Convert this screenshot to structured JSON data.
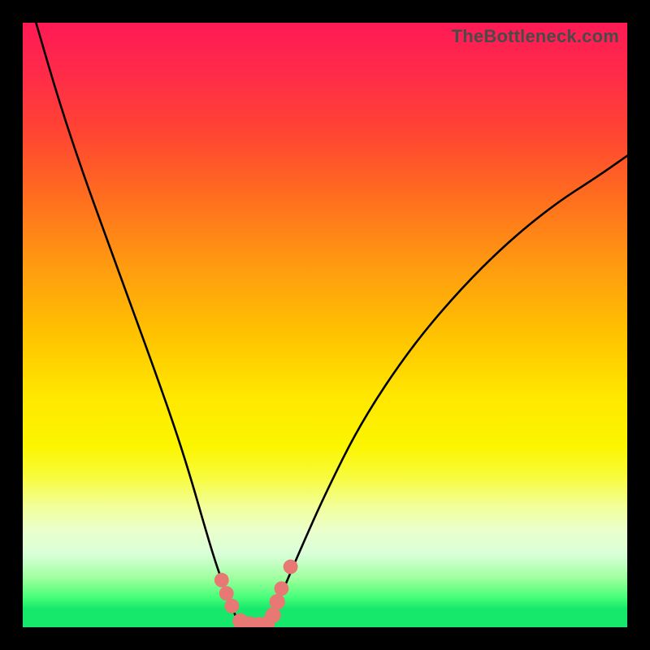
{
  "watermark": "TheBottleneck.com",
  "chart_data": {
    "type": "line",
    "title": "",
    "xlabel": "",
    "ylabel": "",
    "xlim": [
      0,
      1
    ],
    "ylim": [
      0,
      1
    ],
    "background_gradient": [
      {
        "stop": 0.0,
        "color": "#ff1a55"
      },
      {
        "stop": 0.5,
        "color": "#ffc400"
      },
      {
        "stop": 0.8,
        "color": "#f2ff99"
      },
      {
        "stop": 0.95,
        "color": "#48ff7a"
      },
      {
        "stop": 1.0,
        "color": "#15e86b"
      }
    ],
    "series": [
      {
        "name": "left-curve",
        "stroke": "#000000",
        "x": [
          0.022,
          0.06,
          0.1,
          0.14,
          0.18,
          0.22,
          0.255,
          0.28,
          0.3,
          0.318,
          0.332,
          0.345,
          0.356
        ],
        "y": [
          1.0,
          0.87,
          0.75,
          0.64,
          0.53,
          0.42,
          0.32,
          0.24,
          0.17,
          0.11,
          0.07,
          0.035,
          0.01
        ]
      },
      {
        "name": "right-curve",
        "stroke": "#000000",
        "x": [
          0.41,
          0.43,
          0.46,
          0.5,
          0.56,
          0.64,
          0.72,
          0.8,
          0.88,
          0.95,
          1.0
        ],
        "y": [
          0.01,
          0.06,
          0.13,
          0.22,
          0.34,
          0.46,
          0.555,
          0.635,
          0.7,
          0.745,
          0.78
        ]
      },
      {
        "name": "valley-floor",
        "stroke": "#000000",
        "x": [
          0.356,
          0.38,
          0.4,
          0.41
        ],
        "y": [
          0.01,
          0.0,
          0.0,
          0.01
        ]
      }
    ],
    "markers": [
      {
        "name": "left-marker-1",
        "x": 0.329,
        "y": 0.078,
        "r": 0.012,
        "color": "#e77874"
      },
      {
        "name": "left-marker-2",
        "x": 0.337,
        "y": 0.056,
        "r": 0.012,
        "color": "#e77874"
      },
      {
        "name": "left-marker-3",
        "x": 0.346,
        "y": 0.035,
        "r": 0.012,
        "color": "#e77874"
      },
      {
        "name": "floor-marker-1",
        "x": 0.36,
        "y": 0.01,
        "r": 0.013,
        "color": "#e77874"
      },
      {
        "name": "floor-marker-2",
        "x": 0.375,
        "y": 0.005,
        "r": 0.013,
        "color": "#e77874"
      },
      {
        "name": "floor-marker-3",
        "x": 0.39,
        "y": 0.004,
        "r": 0.013,
        "color": "#e77874"
      },
      {
        "name": "floor-marker-4",
        "x": 0.404,
        "y": 0.006,
        "r": 0.013,
        "color": "#e77874"
      },
      {
        "name": "right-marker-1",
        "x": 0.414,
        "y": 0.02,
        "r": 0.013,
        "color": "#e77874"
      },
      {
        "name": "right-marker-2",
        "x": 0.421,
        "y": 0.042,
        "r": 0.013,
        "color": "#e77874"
      },
      {
        "name": "right-marker-3",
        "x": 0.428,
        "y": 0.064,
        "r": 0.012,
        "color": "#e77874"
      },
      {
        "name": "right-marker-4",
        "x": 0.443,
        "y": 0.1,
        "r": 0.012,
        "color": "#e77874"
      }
    ]
  }
}
